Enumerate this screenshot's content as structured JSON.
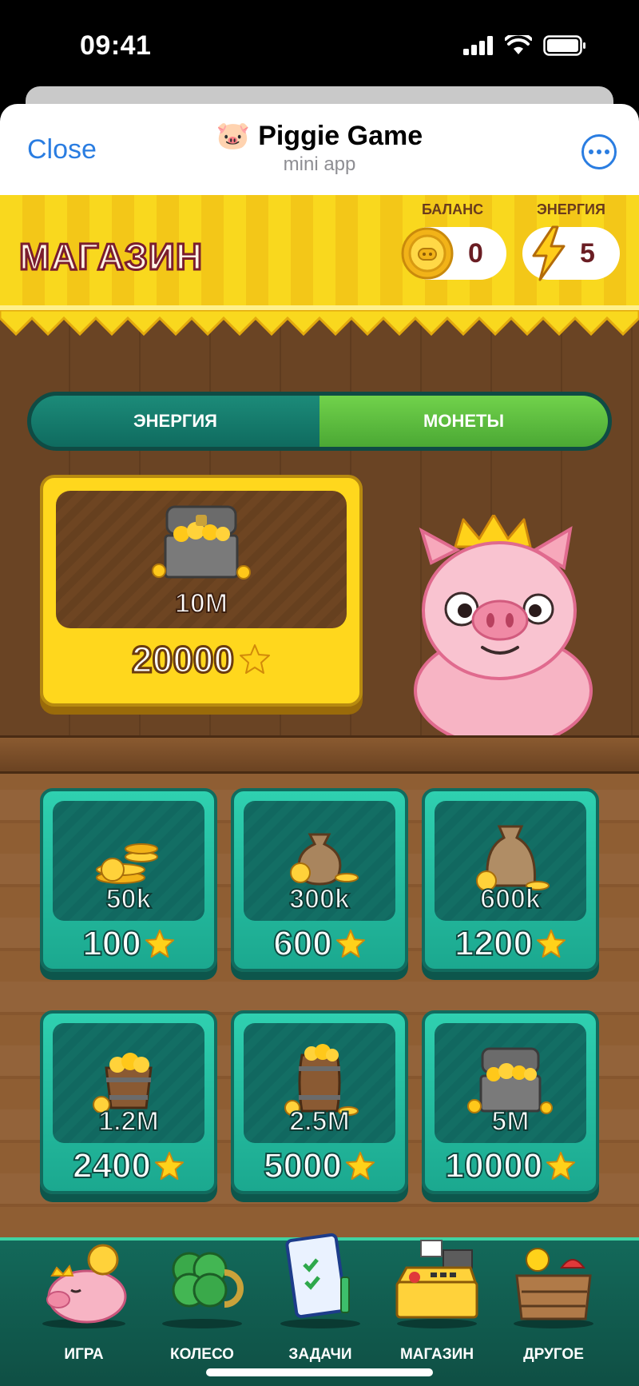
{
  "status_bar": {
    "time": "09:41"
  },
  "telegram": {
    "close_label": "Close",
    "app_title": "Piggie Game",
    "app_emoji": "🐷",
    "app_subtitle": "mini app",
    "more_icon": "more-dots-icon"
  },
  "header": {
    "title": "МАГАЗИН",
    "balance_label": "БАЛАНС",
    "balance_value": "0",
    "energy_label": "ЭНЕРГИЯ",
    "energy_value": "5"
  },
  "tabs": [
    {
      "label": "ЭНЕРГИЯ",
      "active": false
    },
    {
      "label": "МОНЕТЫ",
      "active": true
    }
  ],
  "featured": {
    "amount": "10M",
    "price": "20000",
    "icon": "treasure-chest-icon"
  },
  "packs": [
    {
      "amount": "50k",
      "price": "100",
      "icon": "coin-stack-icon"
    },
    {
      "amount": "300k",
      "price": "600",
      "icon": "coin-bag-small-icon"
    },
    {
      "amount": "600k",
      "price": "1200",
      "icon": "coin-bag-large-icon"
    },
    {
      "amount": "1.2M",
      "price": "2400",
      "icon": "coin-bucket-icon"
    },
    {
      "amount": "2.5M",
      "price": "5000",
      "icon": "coin-barrel-icon"
    },
    {
      "amount": "5M",
      "price": "10000",
      "icon": "treasure-chest-icon"
    }
  ],
  "nav": [
    {
      "label": "ИГРА",
      "icon": "piggy-bank-icon"
    },
    {
      "label": "КОЛЕСО",
      "icon": "clover-icon"
    },
    {
      "label": "ЗАДАЧИ",
      "icon": "checklist-icon"
    },
    {
      "label": "МАГАЗИН",
      "icon": "cash-register-icon"
    },
    {
      "label": "ДРУГОЕ",
      "icon": "toy-box-icon"
    }
  ],
  "colors": {
    "link_blue": "#2a7de1",
    "header_yellow": "#f9d81e",
    "card_teal": "#1ba88f",
    "tab_active_green": "#4ba834"
  }
}
